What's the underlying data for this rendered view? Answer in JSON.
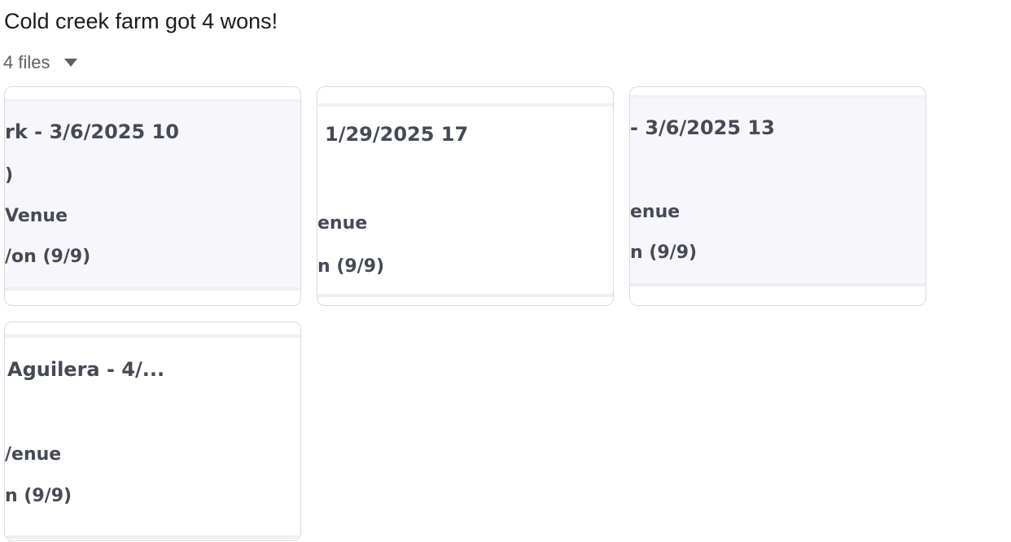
{
  "message": {
    "text": "Cold creek farm got 4 wons!"
  },
  "files": {
    "count_label": "4 files",
    "caret_icon": "caret-down-icon",
    "cards": [
      {
        "preview_bg": "#f7f7fb",
        "lines": [
          "rk - 3/6/2025 10",
          ")",
          "Venue",
          "/on (9/9)"
        ]
      },
      {
        "preview_bg": "#ffffff",
        "lines": [
          "1/29/2025 17",
          "",
          "enue",
          "n (9/9)"
        ]
      },
      {
        "preview_bg": "#f7f7fb",
        "lines": [
          "- 3/6/2025 13",
          "",
          "enue",
          "n (9/9)"
        ]
      },
      {
        "preview_bg": "#ffffff",
        "lines": [
          "Aguilera - 4/...",
          "",
          "/enue",
          "n (9/9)"
        ]
      }
    ]
  }
}
